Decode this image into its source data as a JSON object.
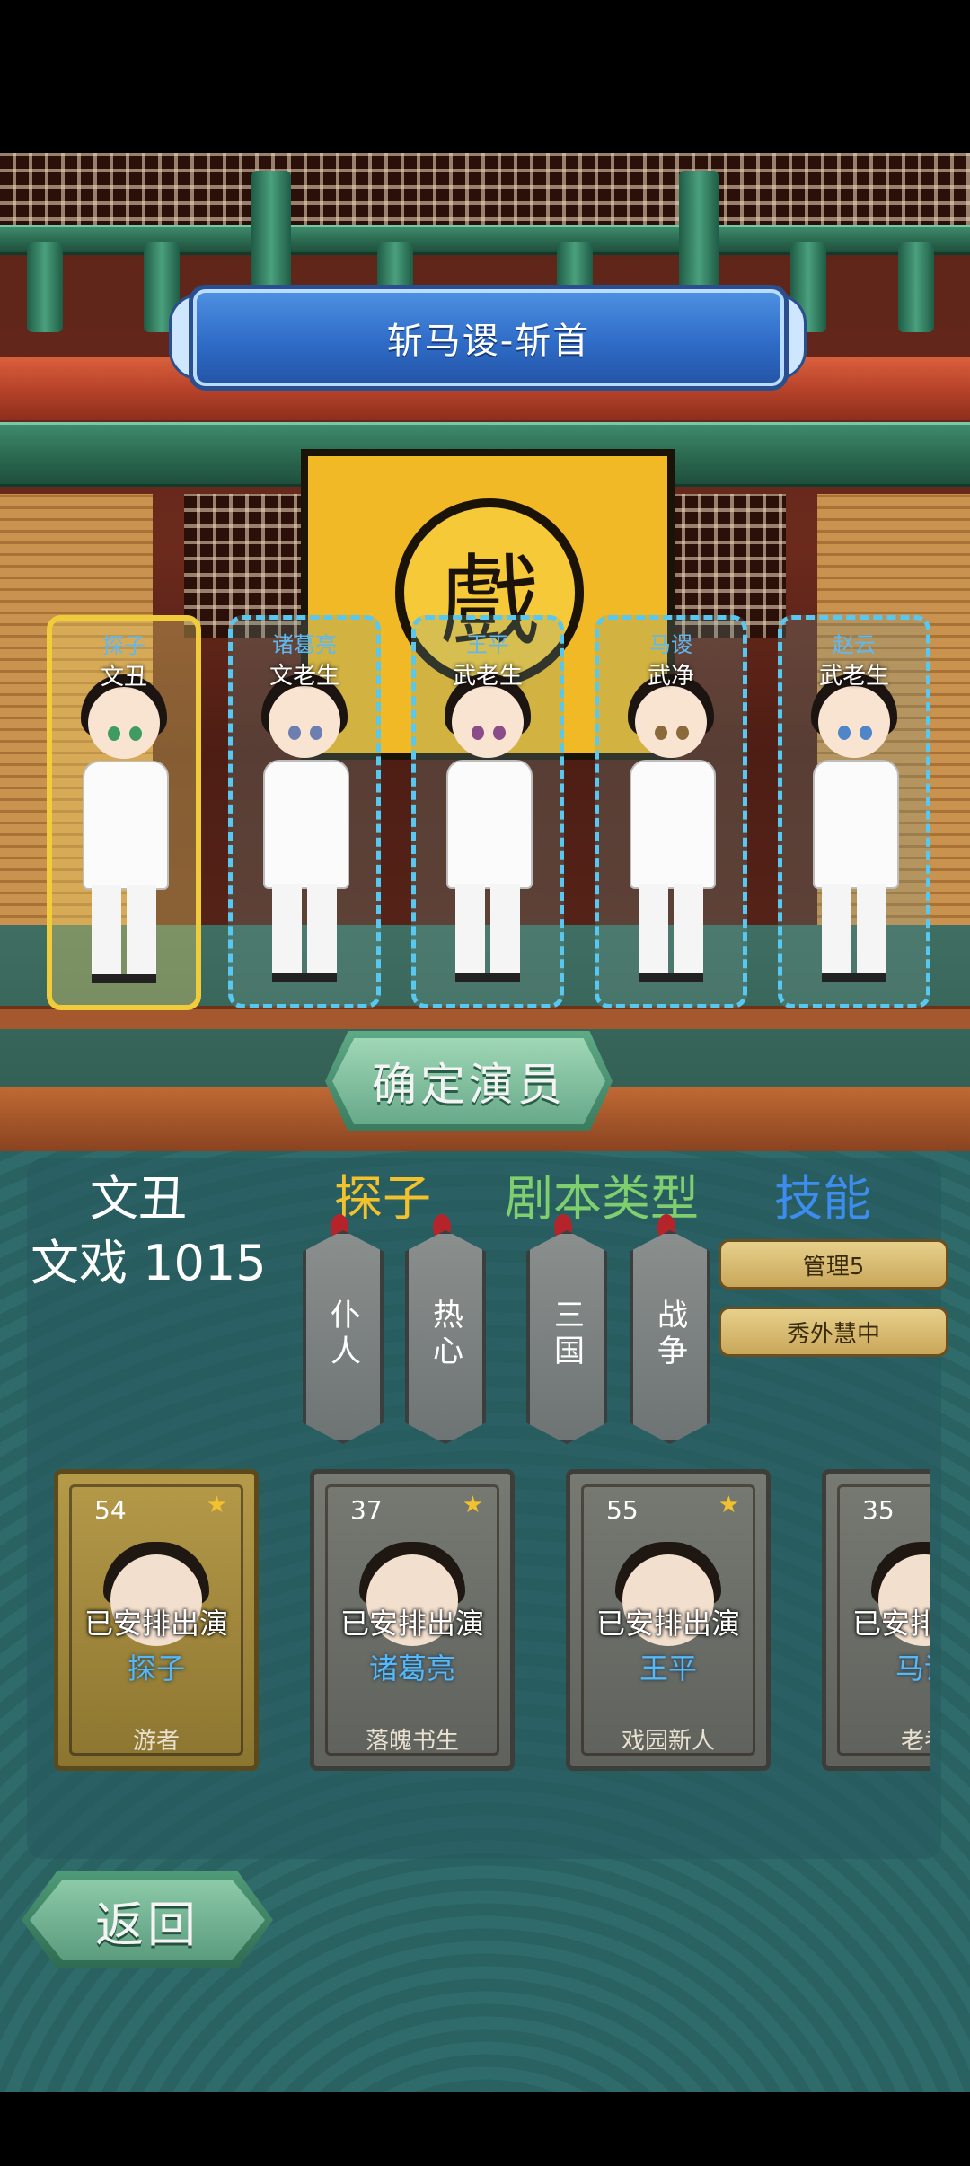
{
  "stage": {
    "title": "斩马谡-斩首",
    "sign_char": "戲",
    "confirm_label": "确定演员"
  },
  "slots": [
    {
      "role": "探子",
      "role_type": "文丑",
      "selected": true,
      "eye_color": "#3f9b62"
    },
    {
      "role": "诸葛亮",
      "role_type": "文老生",
      "selected": false,
      "eye_color": "#6d7fb0"
    },
    {
      "role": "王平",
      "role_type": "武老生",
      "selected": false,
      "eye_color": "#8a4d8a"
    },
    {
      "role": "马谡",
      "role_type": "武净",
      "selected": false,
      "eye_color": "#8a6a3a"
    },
    {
      "role": "赵云",
      "role_type": "武老生",
      "selected": false,
      "eye_color": "#4f86c9"
    }
  ],
  "info": {
    "role_type": "文丑",
    "play_info": "文戏 1015",
    "header_role": "探子",
    "header_script": "剧本类型",
    "header_skill": "技能"
  },
  "tags": [
    "仆人",
    "热心",
    "三国",
    "战争"
  ],
  "skills": [
    "管理5",
    "秀外慧中"
  ],
  "cards": [
    {
      "level": "54",
      "status": "已安排出演",
      "name": "探子",
      "title": "游者",
      "gold": true
    },
    {
      "level": "37",
      "status": "已安排出演",
      "name": "诸葛亮",
      "title": "落魄书生",
      "gold": false
    },
    {
      "level": "55",
      "status": "已安排出演",
      "name": "王平",
      "title": "戏园新人",
      "gold": false
    },
    {
      "level": "35",
      "status": "已安排出演",
      "name": "马谡",
      "title": "老考",
      "gold": false
    }
  ],
  "back_label": "返回",
  "colors": {
    "accent_gold": "#f2c12e",
    "accent_blue": "#3d8df0",
    "accent_green": "#7fcf6e"
  }
}
